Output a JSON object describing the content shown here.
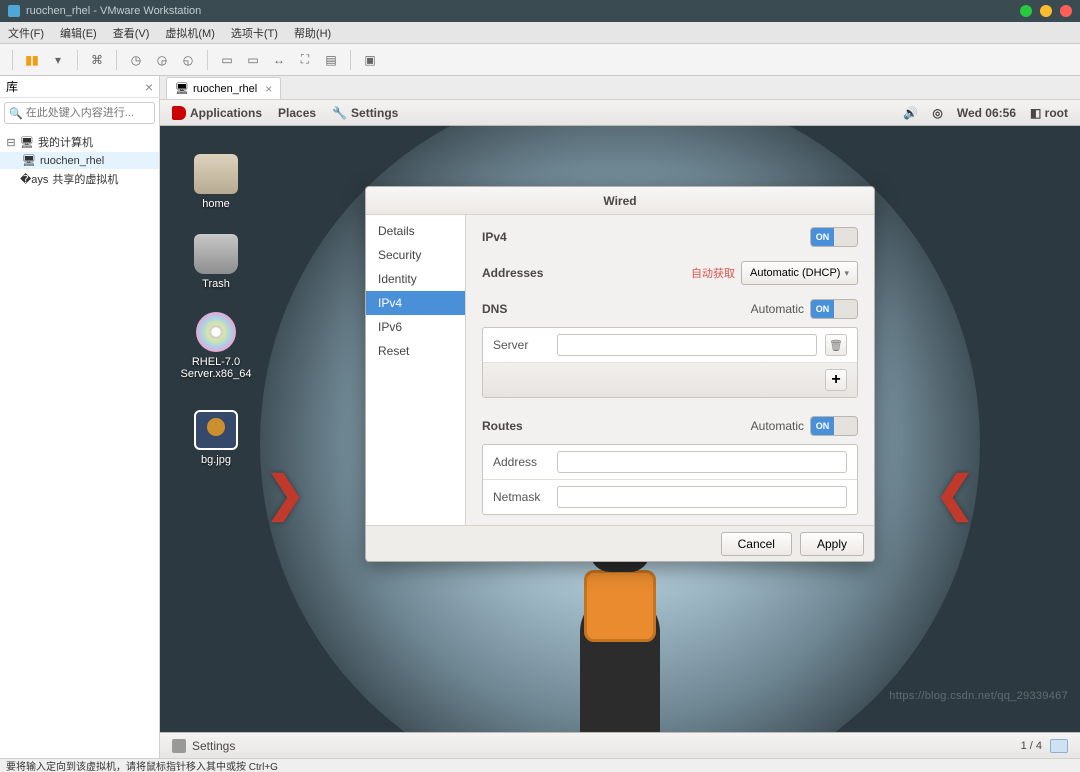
{
  "os_title": "ruochen_rhel - VMware Workstation",
  "menu": {
    "file": "文件(F)",
    "edit": "编辑(E)",
    "view": "查看(V)",
    "vm": "虚拟机(M)",
    "tabs": "选项卡(T)",
    "help": "帮助(H)"
  },
  "library": {
    "header": "库",
    "search_placeholder": "在此处键入内容进行...",
    "root": "我的计算机",
    "child": "ruochen_rhel",
    "shared": "共享的虚拟机"
  },
  "vm_tab": "ruochen_rhel",
  "gnome": {
    "applications": "Applications",
    "places": "Places",
    "settings_app": "Settings",
    "clock": "Wed 06:56",
    "user": "root",
    "bottom_settings": "Settings",
    "pager": "1 / 4"
  },
  "desktop_icons": {
    "home": "home",
    "trash": "Trash",
    "cd": "RHEL-7.0 Server.x86_64",
    "bg": "bg.jpg"
  },
  "dialog": {
    "title": "Wired",
    "side": {
      "details": "Details",
      "security": "Security",
      "identity": "Identity",
      "ipv4": "IPv4",
      "ipv6": "IPv6",
      "reset": "Reset"
    },
    "ipv4_label": "IPv4",
    "addresses_label": "Addresses",
    "addresses_note": "自动获取",
    "addresses_mode": "Automatic (DHCP)",
    "dns_label": "DNS",
    "dns_auto_label": "Automatic",
    "server_label": "Server",
    "routes_label": "Routes",
    "routes_auto_label": "Automatic",
    "address_label": "Address",
    "netmask_label": "Netmask",
    "switch_on": "ON",
    "add_symbol": "+",
    "cancel": "Cancel",
    "apply": "Apply"
  },
  "outer_status": "要将输入定向到该虚拟机，请将鼠标指针移入其中或按 Ctrl+G",
  "watermark": "https://blog.csdn.net/qq_29339467"
}
